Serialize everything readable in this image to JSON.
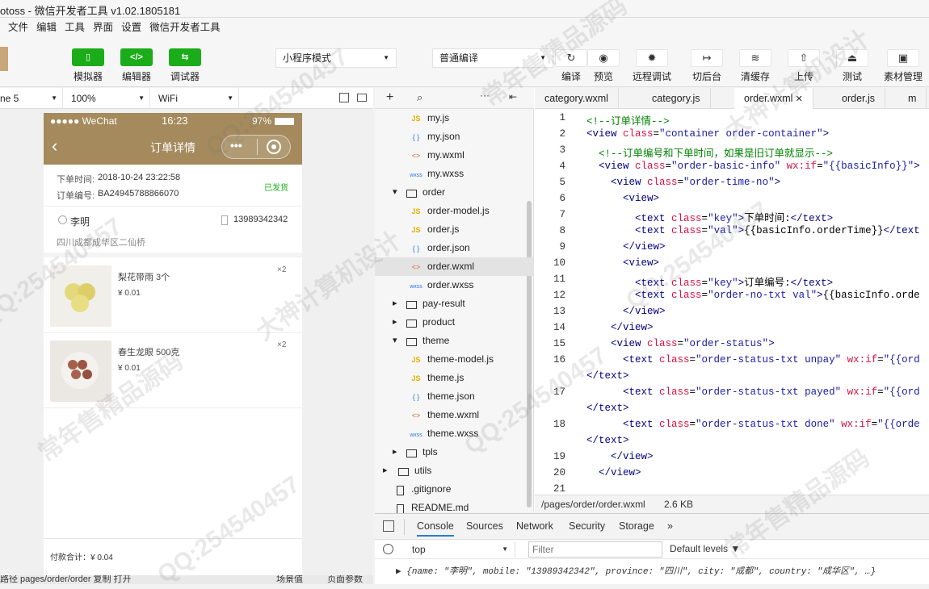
{
  "window": {
    "title": "otoss - 微信开发者工具 v1.02.1805181"
  },
  "menu": [
    "文件",
    "编辑",
    "工具",
    "界面",
    "设置",
    "微信开发者工具"
  ],
  "toolbar": {
    "simulator": "模拟器",
    "editor": "编辑器",
    "debugger": "调试器",
    "mode": "小程序模式",
    "compile": "普通编译",
    "actions": [
      "编译",
      "预览",
      "远程调试",
      "切后台",
      "清缓存",
      "上传",
      "测试",
      "素材管理"
    ]
  },
  "devbar": {
    "device": "ne 5",
    "zoom": "100%",
    "network": "WiFi"
  },
  "phone": {
    "carrier": "●●●●● WeChat",
    "time": "16:23",
    "battery": "97%",
    "nav_title": "订单详情",
    "order": {
      "time_key": "下单时间:",
      "time_val": "2018-10-24 23:22:58",
      "no_key": "订单编号:",
      "no_val": "BA24945788866070",
      "status": "已发货"
    },
    "address": {
      "name": "李明",
      "phone": "13989342342",
      "addr": "四川成都成华区二仙桥"
    },
    "items": [
      {
        "name": "梨花带雨 3个",
        "price": "¥ 0.01",
        "qty": "×2"
      },
      {
        "name": "春生龙眼 500克",
        "price": "¥ 0.01",
        "qty": "×2"
      }
    ],
    "total": "付款合计：¥ 0.04"
  },
  "tree": [
    {
      "type": "js",
      "label": "my.js",
      "depth": 2
    },
    {
      "type": "json",
      "label": "my.json",
      "depth": 2
    },
    {
      "type": "wxml",
      "label": "my.wxml",
      "depth": 2
    },
    {
      "type": "wxss",
      "label": "my.wxss",
      "depth": 2
    },
    {
      "type": "folder-open",
      "label": "order",
      "depth": 1
    },
    {
      "type": "js",
      "label": "order-model.js",
      "depth": 2
    },
    {
      "type": "js",
      "label": "order.js",
      "depth": 2
    },
    {
      "type": "json",
      "label": "order.json",
      "depth": 2
    },
    {
      "type": "wxml",
      "label": "order.wxml",
      "depth": 2,
      "selected": true
    },
    {
      "type": "wxss",
      "label": "order.wxss",
      "depth": 2
    },
    {
      "type": "folder",
      "label": "pay-result",
      "depth": 1
    },
    {
      "type": "folder",
      "label": "product",
      "depth": 1
    },
    {
      "type": "folder-open",
      "label": "theme",
      "depth": 1
    },
    {
      "type": "js",
      "label": "theme-model.js",
      "depth": 2
    },
    {
      "type": "js",
      "label": "theme.js",
      "depth": 2
    },
    {
      "type": "json",
      "label": "theme.json",
      "depth": 2
    },
    {
      "type": "wxml",
      "label": "theme.wxml",
      "depth": 2
    },
    {
      "type": "wxss",
      "label": "theme.wxss",
      "depth": 2
    },
    {
      "type": "folder",
      "label": "tpls",
      "depth": 1
    },
    {
      "type": "folder",
      "label": "utils",
      "depth": 0
    },
    {
      "type": "file",
      "label": ".gitignore",
      "depth": 0
    },
    {
      "type": "file",
      "label": "README.md",
      "depth": 0
    }
  ],
  "icons": {
    "js": "JS",
    "json": "{ }",
    "wxml": "<>",
    "wxss": "wxss"
  },
  "tabs": [
    {
      "label": "category.wxml"
    },
    {
      "label": "category.js"
    },
    {
      "label": "order.wxml",
      "active": true
    },
    {
      "label": "order.js"
    },
    {
      "label": "m"
    }
  ],
  "code": [
    {
      "n": "1",
      "segs": [
        [
          "c-com",
          "<!--订单详情-->"
        ]
      ]
    },
    {
      "n": "2",
      "segs": [
        [
          "c-tag",
          "<view "
        ],
        [
          "c-attr",
          "class"
        ],
        [
          "c-txt",
          "="
        ],
        [
          "c-str",
          "\"container order-container\""
        ],
        [
          "c-tag",
          ">"
        ]
      ]
    },
    {
      "n": "3",
      "segs": [
        [
          "c-com",
          "  <!--订单编号和下单时间，如果是旧订单就显示-->"
        ]
      ]
    },
    {
      "n": "4",
      "segs": [
        [
          "c-tag",
          "  <view "
        ],
        [
          "c-attr",
          "class"
        ],
        [
          "c-txt",
          "="
        ],
        [
          "c-str",
          "\"order-basic-info\" "
        ],
        [
          "c-attr",
          "wx:if"
        ],
        [
          "c-txt",
          "="
        ],
        [
          "c-str",
          "\"{{basicInfo}}\""
        ],
        [
          "c-tag",
          ">"
        ]
      ]
    },
    {
      "n": "5",
      "segs": [
        [
          "c-tag",
          "    <view "
        ],
        [
          "c-attr",
          "class"
        ],
        [
          "c-txt",
          "="
        ],
        [
          "c-str",
          "\"order-time-no\""
        ],
        [
          "c-tag",
          ">"
        ]
      ]
    },
    {
      "n": "6",
      "segs": [
        [
          "c-tag",
          "      <view>"
        ]
      ]
    },
    {
      "n": "7",
      "segs": [
        [
          "c-tag",
          "        <text "
        ],
        [
          "c-attr",
          "class"
        ],
        [
          "c-txt",
          "="
        ],
        [
          "c-str",
          "\"key\""
        ],
        [
          "c-tag",
          ">"
        ],
        [
          "c-txt",
          "下单时间:"
        ],
        [
          "c-tag",
          "</text>"
        ]
      ]
    },
    {
      "n": "8",
      "segs": [
        [
          "c-tag",
          "        <text "
        ],
        [
          "c-attr",
          "class"
        ],
        [
          "c-txt",
          "="
        ],
        [
          "c-str",
          "\"val\""
        ],
        [
          "c-tag",
          ">"
        ],
        [
          "c-txt",
          "{{basicInfo.orderTime}}"
        ],
        [
          "c-tag",
          "</text"
        ]
      ]
    },
    {
      "n": "9",
      "segs": [
        [
          "c-tag",
          "      </view>"
        ]
      ]
    },
    {
      "n": "10",
      "segs": [
        [
          "c-tag",
          "      <view>"
        ]
      ]
    },
    {
      "n": "11",
      "segs": [
        [
          "c-tag",
          "        <text "
        ],
        [
          "c-attr",
          "class"
        ],
        [
          "c-txt",
          "="
        ],
        [
          "c-str",
          "\"key\""
        ],
        [
          "c-tag",
          ">"
        ],
        [
          "c-txt",
          "订单编号:"
        ],
        [
          "c-tag",
          "</text>"
        ]
      ]
    },
    {
      "n": "12",
      "segs": [
        [
          "c-tag",
          "        <text "
        ],
        [
          "c-attr",
          "class"
        ],
        [
          "c-txt",
          "="
        ],
        [
          "c-str",
          "\"order-no-txt val\""
        ],
        [
          "c-tag",
          ">"
        ],
        [
          "c-txt",
          "{{basicInfo.orde"
        ]
      ]
    },
    {
      "n": "13",
      "segs": [
        [
          "c-tag",
          "      </view>"
        ]
      ]
    },
    {
      "n": "14",
      "segs": [
        [
          "c-tag",
          "    </view>"
        ]
      ]
    },
    {
      "n": "15",
      "segs": [
        [
          "c-tag",
          "    <view "
        ],
        [
          "c-attr",
          "class"
        ],
        [
          "c-txt",
          "="
        ],
        [
          "c-str",
          "\"order-status\""
        ],
        [
          "c-tag",
          ">"
        ]
      ]
    },
    {
      "n": "16",
      "segs": [
        [
          "c-tag",
          "      <text "
        ],
        [
          "c-attr",
          "class"
        ],
        [
          "c-txt",
          "="
        ],
        [
          "c-str",
          "\"order-status-txt unpay\" "
        ],
        [
          "c-attr",
          "wx:if"
        ],
        [
          "c-txt",
          "="
        ],
        [
          "c-str",
          "\"{{ord"
        ]
      ]
    },
    {
      "n": "",
      "segs": [
        [
          "c-tag",
          "</text>"
        ]
      ],
      "wrap": true
    },
    {
      "n": "17",
      "segs": [
        [
          "c-tag",
          "      <text "
        ],
        [
          "c-attr",
          "class"
        ],
        [
          "c-txt",
          "="
        ],
        [
          "c-str",
          "\"order-status-txt payed\" "
        ],
        [
          "c-attr",
          "wx:if"
        ],
        [
          "c-txt",
          "="
        ],
        [
          "c-str",
          "\"{{ord"
        ]
      ]
    },
    {
      "n": "",
      "segs": [
        [
          "c-tag",
          "</text>"
        ]
      ],
      "wrap": true
    },
    {
      "n": "18",
      "segs": [
        [
          "c-tag",
          "      <text "
        ],
        [
          "c-attr",
          "class"
        ],
        [
          "c-txt",
          "="
        ],
        [
          "c-str",
          "\"order-status-txt done\" "
        ],
        [
          "c-attr",
          "wx:if"
        ],
        [
          "c-txt",
          "="
        ],
        [
          "c-str",
          "\"{{orde"
        ]
      ]
    },
    {
      "n": "",
      "segs": [
        [
          "c-tag",
          "</text>"
        ]
      ],
      "wrap": true
    },
    {
      "n": "19",
      "segs": [
        [
          "c-tag",
          "    </view>"
        ]
      ]
    },
    {
      "n": "20",
      "segs": [
        [
          "c-tag",
          "  </view>"
        ]
      ]
    },
    {
      "n": "21",
      "segs": []
    }
  ],
  "codestatus": {
    "path": "/pages/order/order.wxml",
    "size": "2.6 KB"
  },
  "console": {
    "tabs": [
      "Console",
      "Sources",
      "Network",
      "Security",
      "Storage"
    ],
    "more": "»",
    "context": "top",
    "filter_placeholder": "Filter",
    "levels": "Default levels ▼",
    "log": "▶ {name: \"李明\", mobile: \"13989342342\", province: \"四川\", city: \"成都\", country: \"成华区\", …}"
  },
  "bottombar": {
    "route": "路径   pages/order/order  复制  打开",
    "scene": "场景值",
    "params": "页面参数"
  },
  "watermarks": [
    "QQ:254540457",
    "大神计算机设计",
    "常年售精品源码"
  ],
  "colors": {
    "nav": "#a48a5c",
    "green": "#1aad19",
    "status": "#1aad19"
  }
}
